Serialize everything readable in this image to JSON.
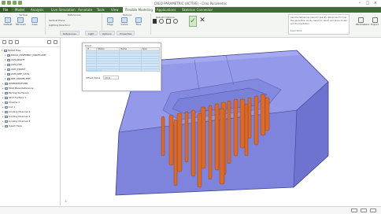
{
  "app": {
    "title": "CREO PARAMETRIC (ACTIVE) - Creo Parametric",
    "window_controls": [
      "–",
      "□",
      "×"
    ]
  },
  "tabs": {
    "file": "File",
    "items": [
      "Model",
      "Analysis",
      "Live Simulation",
      "Annotate",
      "Tools",
      "View",
      "Flexible Modeling",
      "Applications",
      "Skeleton Connector"
    ]
  },
  "ribbon": {
    "group_vertical": {
      "label": "Vertical",
      "buttons": [
        "Default",
        "Mirrored",
        "Axes"
      ]
    },
    "group_reference": {
      "label": "References",
      "lines": [
        "Vertical Plane",
        "Lighting Direction"
      ]
    },
    "group_options": {
      "label": "Options",
      "buttons": [
        "Edge",
        "Curve",
        "Face"
      ]
    },
    "dialog_title": "Rebuild Options",
    "ok_label": "✓",
    "cancel_label": "✕",
    "info_text": "Use the references panel to specify references for how the generation works. Select to select and place model and its orientation.",
    "more_link": "Learn More",
    "side_buttons": [
      "Parameters",
      "Export"
    ]
  },
  "subtabs": [
    "References",
    "Light",
    "Options",
    "Properties"
  ],
  "sidebar": {
    "tree": [
      "Model Tree",
      "MOLD_ASSEMBLY_DRAFT.ASM",
      "ASM_RIGHT",
      "ASM_TOP",
      "ASM_FRONT",
      "ASM_DEF_CSYS",
      "REF_MODEL.PRT",
      "WORKPIECE.PRT",
      "Mold Base Reference",
      "Parting Surface 1",
      "Skirt Surface 1",
      "Volume 1",
      "Cut 1",
      "Cooling Channel 1",
      "Cooling Channel 2",
      "Cooling Channel 3",
      "Insert Here"
    ]
  },
  "dialog": {
    "title": "Layer",
    "columns": [
      "#",
      "Status",
      "Name",
      "Type"
    ],
    "rows": [
      "",
      "",
      "",
      "",
      "",
      "",
      "",
      ""
    ],
    "unit_label": "Offset Value",
    "unit_value": "10.0"
  },
  "colors": {
    "accent": "#3e6b33",
    "model_top": "#8f93e8",
    "model_side": "#7479d4",
    "pins": "#d96a2c"
  }
}
